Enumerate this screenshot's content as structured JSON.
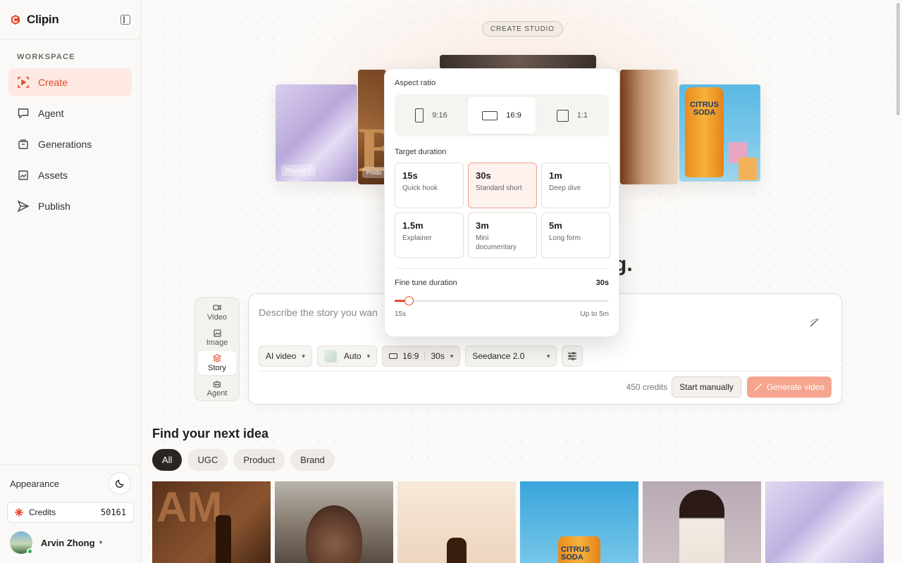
{
  "app": {
    "name": "Clipin"
  },
  "sidebar": {
    "section_label": "WORKSPACE",
    "items": [
      {
        "label": "Create",
        "icon": "create-icon",
        "active": true
      },
      {
        "label": "Agent",
        "icon": "chat-icon",
        "active": false
      },
      {
        "label": "Generations",
        "icon": "generations-icon",
        "active": false
      },
      {
        "label": "Assets",
        "icon": "assets-icon",
        "active": false
      },
      {
        "label": "Publish",
        "icon": "send-icon",
        "active": false
      }
    ],
    "appearance_label": "Appearance",
    "credits_label": "Credits",
    "credits_value": "50161",
    "user_name": "Arvin Zhong"
  },
  "hero": {
    "studio_label": "CREATE STUDIO",
    "heading_fragment": "g.",
    "product_chip": "Product",
    "product_chip_2": "Produ",
    "soda_label": "CITRUS SODA"
  },
  "modes": [
    {
      "label": "Video",
      "icon": "video-icon",
      "active": false
    },
    {
      "label": "Image",
      "icon": "image-icon",
      "active": false
    },
    {
      "label": "Story",
      "icon": "layers-icon",
      "active": true
    },
    {
      "label": "Agent",
      "icon": "robot-icon",
      "active": false
    }
  ],
  "composer": {
    "placeholder": "Describe the story you wan",
    "type_select": "AI video",
    "style_select": "Auto",
    "ratio_value": "16:9",
    "duration_value": "30s",
    "model_select": "Seedance 2.0",
    "credits_text": "450 credits",
    "start_manually": "Start manually",
    "generate": "Generate video"
  },
  "popover": {
    "aspect_label": "Aspect ratio",
    "ratios": [
      {
        "label": "9:16",
        "active": false
      },
      {
        "label": "16:9",
        "active": true
      },
      {
        "label": "1:1",
        "active": false
      }
    ],
    "duration_label": "Target duration",
    "durations": [
      {
        "value": "15s",
        "desc": "Quick hook",
        "active": false
      },
      {
        "value": "30s",
        "desc": "Standard short",
        "active": true
      },
      {
        "value": "1m",
        "desc": "Deep dive",
        "active": false
      },
      {
        "value": "1.5m",
        "desc": "Explainer",
        "active": false
      },
      {
        "value": "3m",
        "desc": "Mini documentary",
        "active": false
      },
      {
        "value": "5m",
        "desc": "Long form",
        "active": false
      }
    ],
    "fine_label": "Fine tune duration",
    "fine_value": "30s",
    "slider_fraction": 0.067,
    "slider_min_label": "15s",
    "slider_max_label": "Up to 5m"
  },
  "ideas": {
    "title": "Find your next idea",
    "filters": [
      {
        "label": "All",
        "active": true
      },
      {
        "label": "UGC",
        "active": false
      },
      {
        "label": "Product",
        "active": false
      },
      {
        "label": "Brand",
        "active": false
      }
    ],
    "thumb_text_1": "AM",
    "thumb_text_4": "CITRUS SODA"
  },
  "colors": {
    "accent": "#e64a2b",
    "accent_soft": "#fde8e3",
    "generate_btn": "#f5a58f"
  }
}
